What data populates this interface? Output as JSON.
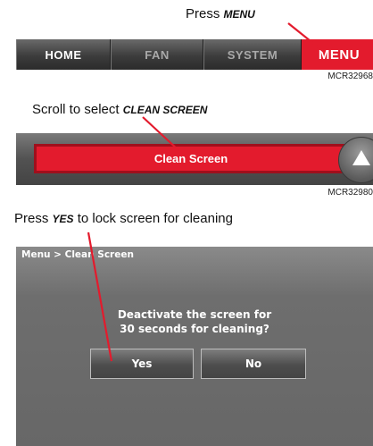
{
  "step1": {
    "caption_prefix": "Press",
    "caption_keyword": "MENU",
    "tabs": [
      {
        "label": "HOME"
      },
      {
        "label": "FAN"
      },
      {
        "label": "SYSTEM"
      },
      {
        "label": "MENU"
      }
    ],
    "ref": "MCR32968",
    "accent": "#e31b2d"
  },
  "step2": {
    "caption_prefix": "Scroll to select",
    "caption_keyword": "CLEAN SCREEN",
    "button_label": "Clean Screen",
    "scroll_icon": "up-arrow-icon",
    "ref": "MCR32980"
  },
  "step3": {
    "caption_prefix": "Press",
    "caption_keyword": "YES",
    "caption_suffix": "to lock screen for cleaning",
    "breadcrumb": "Menu > Clean Screen",
    "prompt_line1": "Deactivate the screen for",
    "prompt_line2": "30 seconds for cleaning?",
    "yes_label": "Yes",
    "no_label": "No"
  }
}
